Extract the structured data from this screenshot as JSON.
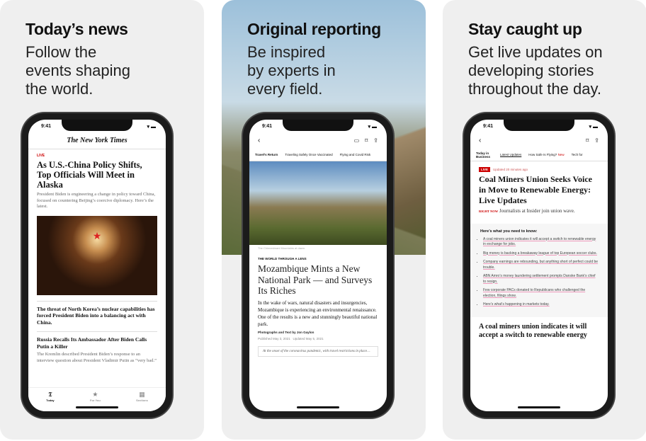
{
  "panels": [
    {
      "title": "Today’s news",
      "subtitle": "Follow the\nevents shaping\nthe world."
    },
    {
      "title": "Original reporting",
      "subtitle": "Be inspired\nby experts in\nevery field."
    },
    {
      "title": "Stay caught up",
      "subtitle": "Get live updates on\ndeveloping stories\nthroughout the day."
    }
  ],
  "status_time": "9:41",
  "phone1": {
    "logo": "The New York Times",
    "live_label": "LIVE",
    "headline": "As U.S.-China Policy Shifts, Top Officials Will Meet in Alaska",
    "summary": "President Biden is engineering a change in policy toward China, focused on countering Beijing’s coercive diplomacy. Here’s the latest.",
    "story2": "The threat of North Korea’s nuclear capabilities has forced President Biden into a balancing act with China.",
    "story3_headline": "Russia Recalls Its Ambassador After Biden Calls Putin a Killer",
    "story3_summary": "The Kremlin described President Biden’s response to an interview question about President Vladimir Putin as “very bad.”",
    "tabs": [
      {
        "label": "Today",
        "icon": "nyt-logo-icon"
      },
      {
        "label": "For You",
        "icon": "star-icon"
      },
      {
        "label": "Sections",
        "icon": "grid-icon"
      }
    ]
  },
  "phone2": {
    "subnav": [
      "Travel’s Return",
      "Traveling Safely Once Vaccinated",
      "Flying and Covid Risk"
    ],
    "caption": "The Chimanimani Mountains at dawn.",
    "kicker": "THE WORLD THROUGH A LENS",
    "headline": "Mozambique Mints a New National Park — and Surveys Its Riches",
    "body": "In the wake of wars, natural disasters and insurgencies, Mozambique is experiencing an environmental renaissance. One of the results is a new and stunningly beautiful national park.",
    "byline": "Photographs and Text by Jon Gaylon",
    "published": "Published May 3, 2021",
    "updated": "Updated May 5, 2021",
    "quote": "At the onset of the coronavirus pandemic, with travel restrictions in place…"
  },
  "phone3": {
    "subnav": [
      "Today in Business",
      "Latest Updates",
      "How Safe Is Flying?",
      "Tech for"
    ],
    "new_label": "New",
    "live": "LIVE",
    "updated": "Updated 20 minutes ago",
    "headline": "Coal Miners Union Seeks Voice in Move to Renewable Energy: Live Updates",
    "right_now": "RIGHT NOW",
    "right_now_text": "Journalists at Insider join union wave.",
    "box_title": "Here’s what you need to know:",
    "bullets": [
      "A coal miners union indicates it will accept a switch to renewable energy in exchange for jobs.",
      "Big money is backing a breakaway league of top European soccer clubs.",
      "Company earnings are rebounding, but anything short of perfect could be trouble.",
      "ABN Amro’s money laundering settlement prompts Danske Bank’s chief to resign.",
      "Few corporate PACs donated to Republicans who challenged the election, filings show.",
      "Here’s what’s happening in markets today."
    ],
    "bottom_headline": "A coal miners union indicates it will accept a switch to renewable energy"
  },
  "colors": {
    "accent_red": "#cc0000",
    "panel_bg": "#efefef"
  }
}
